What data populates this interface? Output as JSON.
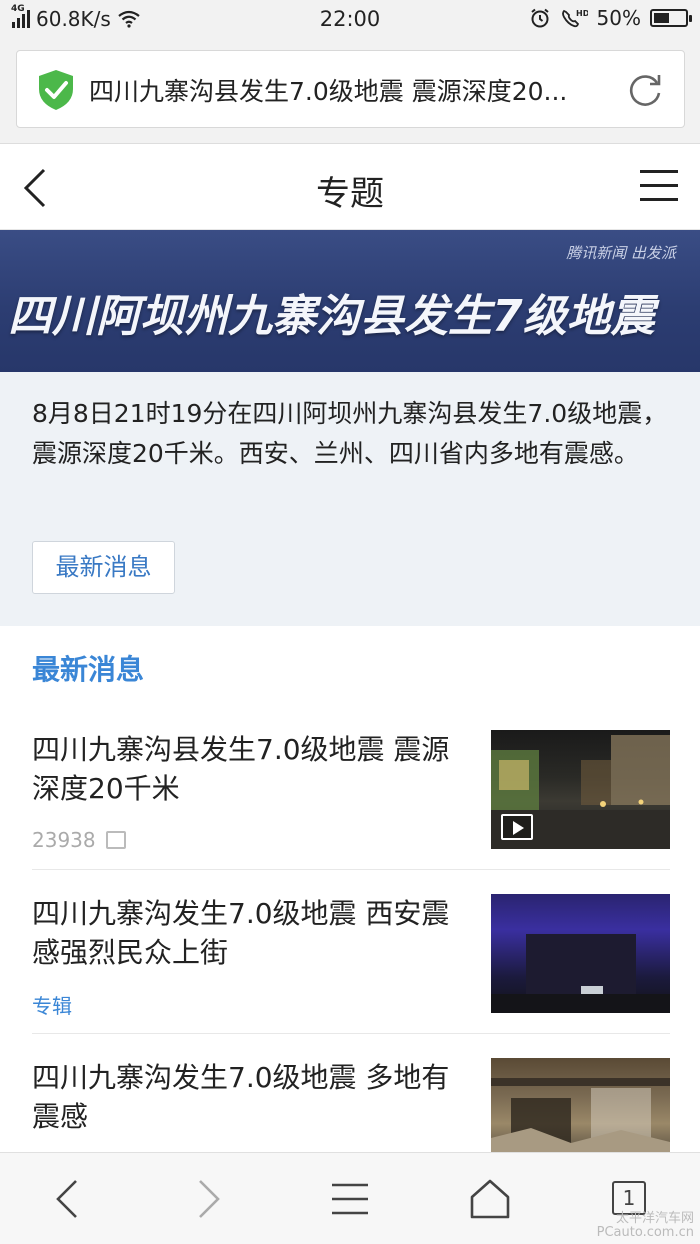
{
  "status_bar": {
    "network_type": "4G",
    "speed": "60.8K/s",
    "time": "22:00",
    "battery": "50%",
    "battery_level": 0.5
  },
  "url_bar": {
    "text": "四川九寨沟县发生7.0级地震 震源深度20..."
  },
  "header": {
    "title": "专题"
  },
  "banner": {
    "brand": "腾讯新闻 出发派",
    "title": "四川阿坝州九寨沟县发生7级地震",
    "bg_color": "#2f4176"
  },
  "summary": {
    "text": "8月8日21时19分在四川阿坝州九寨沟县发生7.0级地震，震源深度20千米。西安、兰州、四川省内多地有震感。",
    "tag_button": "最新消息"
  },
  "section": {
    "title": "最新消息",
    "accent_color": "#3a86d6"
  },
  "news": [
    {
      "headline": "四川九寨沟县发生7.0级地震 震源深度20千米",
      "meta": "23938",
      "thumbnail": "video"
    },
    {
      "headline": "四川九寨沟发生7.0级地震 西安震感强烈民众上街",
      "meta": "专辑",
      "thumbnail": "image"
    },
    {
      "headline": "四川九寨沟发生7.0级地震 多地有震感",
      "meta": "",
      "thumbnail": "image"
    }
  ],
  "bottom_bar": {
    "tab_count": "1"
  },
  "watermark": {
    "line1": "太平洋汽车网",
    "line2": "PCauto.com.cn"
  }
}
